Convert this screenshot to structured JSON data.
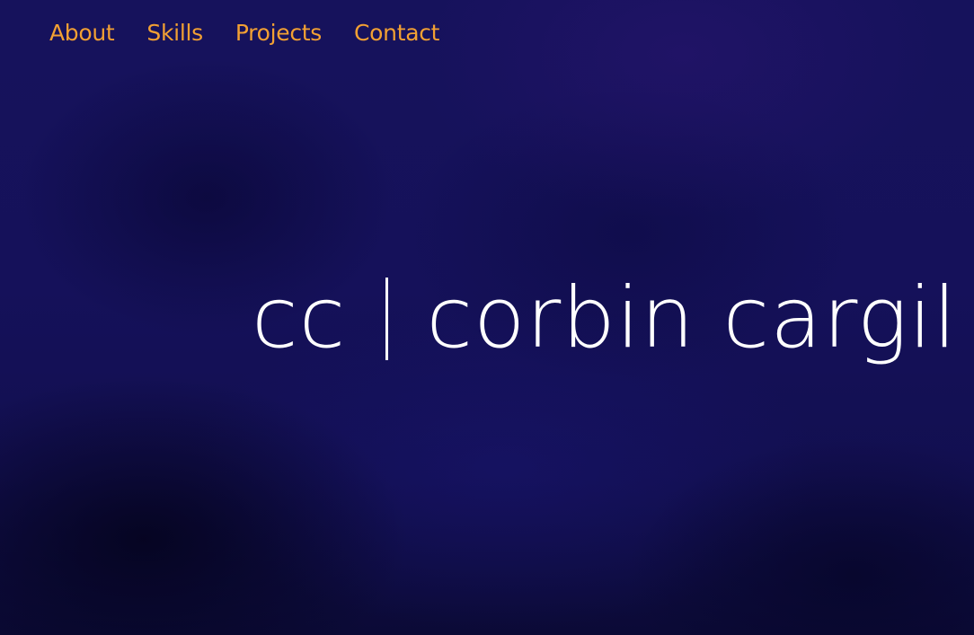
{
  "nav": {
    "items": [
      {
        "label": "About"
      },
      {
        "label": "Skills"
      },
      {
        "label": "Projects"
      },
      {
        "label": "Contact"
      }
    ],
    "link_color": "#f2a033"
  },
  "hero": {
    "monogram": "cc",
    "name": "corbin cargil",
    "background_color": "#15115a"
  }
}
